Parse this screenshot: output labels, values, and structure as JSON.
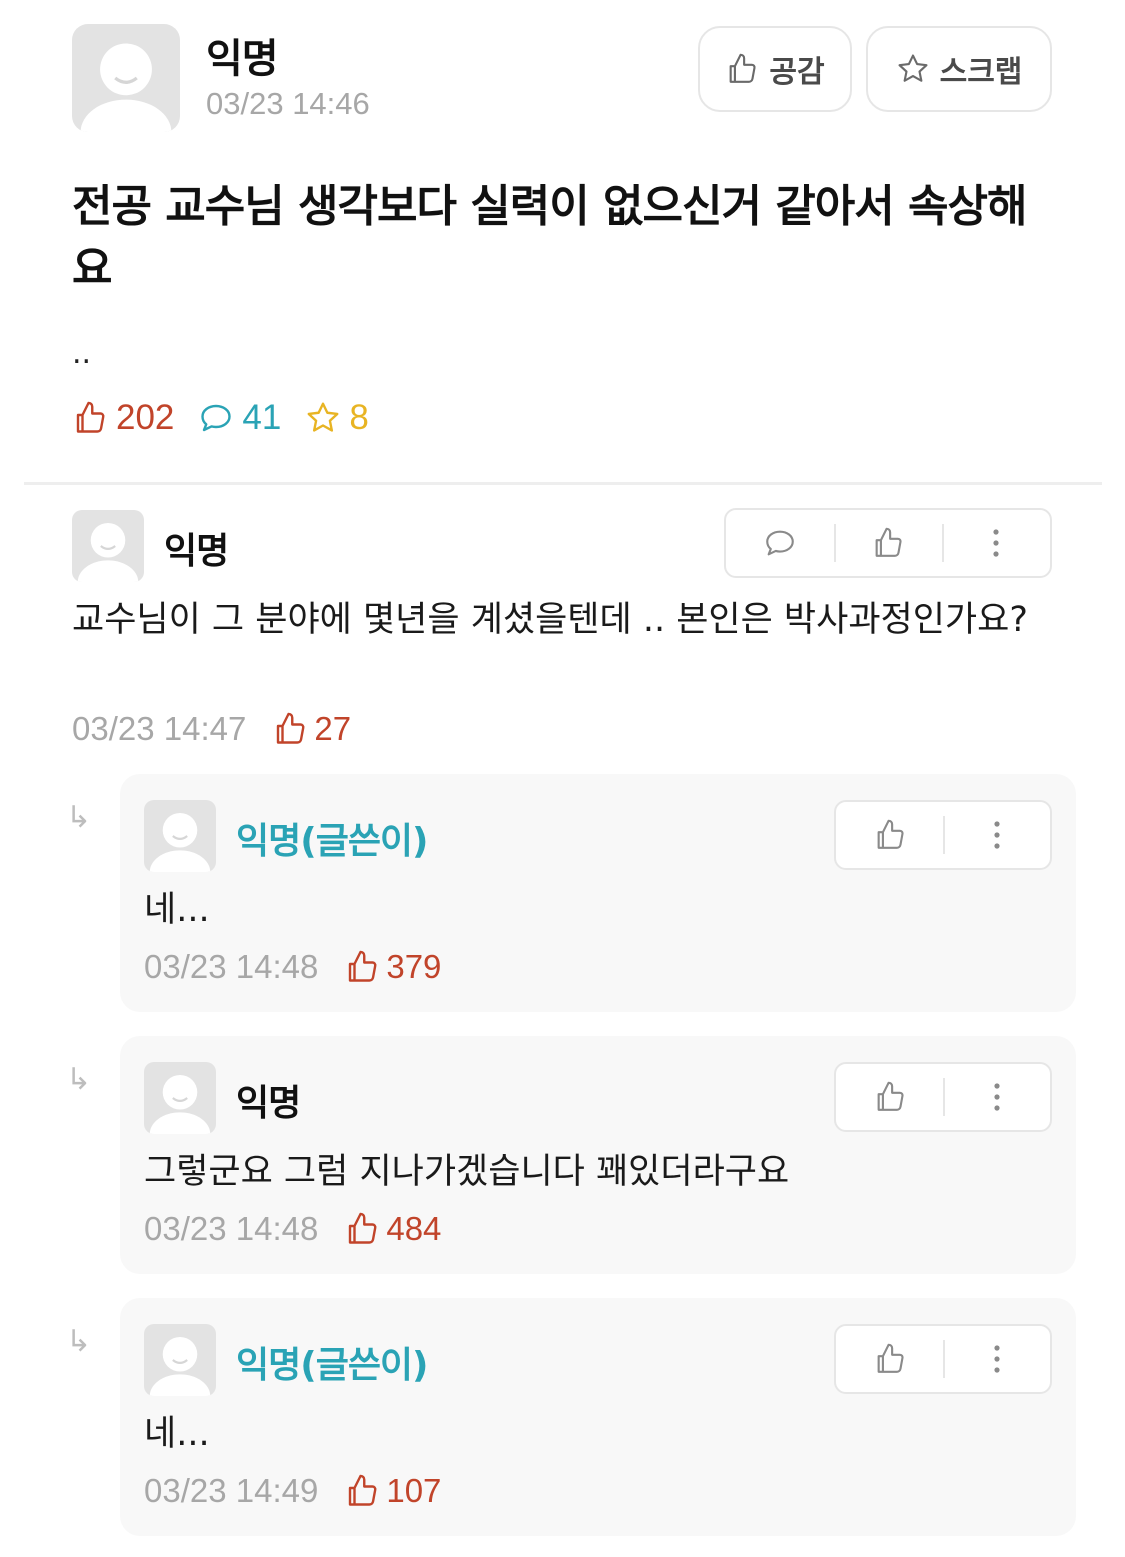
{
  "post": {
    "author": "익명",
    "time": "03/23 14:46",
    "like_label": "공감",
    "scrap_label": "스크랩",
    "title": "전공 교수님 생각보다 실력이 없으신거 같아서 속상해요",
    "body": "..",
    "likes": "202",
    "comments": "41",
    "scraps": "8"
  },
  "comments": [
    {
      "author": "익명",
      "text": "교수님이 그 분야에 몇년을 계셨을텐데 .. 본인은 박사과정인가요?",
      "time": "03/23 14:47",
      "likes": "27"
    }
  ],
  "replies": [
    {
      "author": "익명(글쓴이)",
      "is_op": true,
      "text": "네...",
      "time": "03/23 14:48",
      "likes": "379"
    },
    {
      "author": "익명",
      "is_op": false,
      "text": "그렇군요 그럼 지나가겠습니다 꽤있더라구요",
      "time": "03/23 14:48",
      "likes": "484"
    },
    {
      "author": "익명(글쓴이)",
      "is_op": true,
      "text": "네...",
      "time": "03/23 14:49",
      "likes": "107"
    }
  ],
  "reply_arrow": "↳",
  "colors": {
    "like": "#c1442a",
    "comment": "#2aa3b5",
    "scrap": "#e8b423",
    "muted": "#a7a7a7",
    "op_name": "#2aa3b5"
  },
  "icons": [
    "avatar-placeholder-icon",
    "thumbs-up-icon",
    "star-icon",
    "speech-bubble-icon",
    "more-vertical-icon",
    "reply-arrow-icon"
  ]
}
